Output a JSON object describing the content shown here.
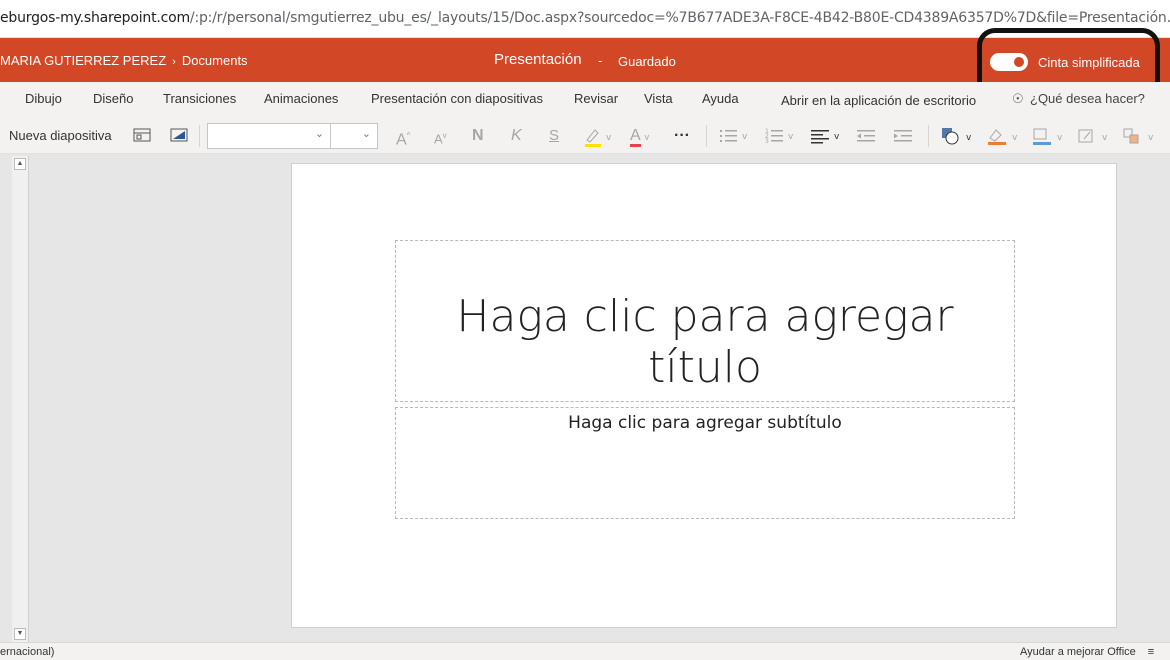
{
  "browser": {
    "url_host": "eburgos-my.sharepoint.com",
    "url_path": "/:p:/r/personal/smgutierrez_ubu_es/_layouts/15/Doc.aspx?sourcedoc=%7B677ADE3A-F8CE-4B42-B80E-CD4389A6357D%7D&file=Presentación.pptx&action=edit&mobileredirect=true"
  },
  "header": {
    "user": "MARIA GUTIERREZ PEREZ",
    "folder": "Documents",
    "document_title": "Presentación",
    "separator": "-",
    "save_status": "Guardado",
    "simplified_ribbon_label": "Cinta simplificada",
    "simplified_ribbon_on": true,
    "accent_color": "#d24726"
  },
  "tabs": [
    "Dibujo",
    "Diseño",
    "Transiciones",
    "Animaciones",
    "Presentación con diapositivas",
    "Revisar",
    "Vista",
    "Ayuda",
    "Abrir en la aplicación de escritorio"
  ],
  "tell_me": "¿Qué desea hacer?",
  "ribbon": {
    "new_slide": "Nueva diapositiva",
    "font_name": "",
    "font_size": "",
    "grow_font": "A",
    "shrink_font": "A",
    "bold": "N",
    "italic": "K",
    "strike": "S",
    "font_color": "A",
    "more": "···"
  },
  "slide": {
    "title_placeholder": "Haga clic para agregar título",
    "subtitle_placeholder": "Haga clic para agregar subtítulo"
  },
  "status": {
    "language": "ernacional)",
    "feedback": "Ayudar a mejorar Office"
  }
}
